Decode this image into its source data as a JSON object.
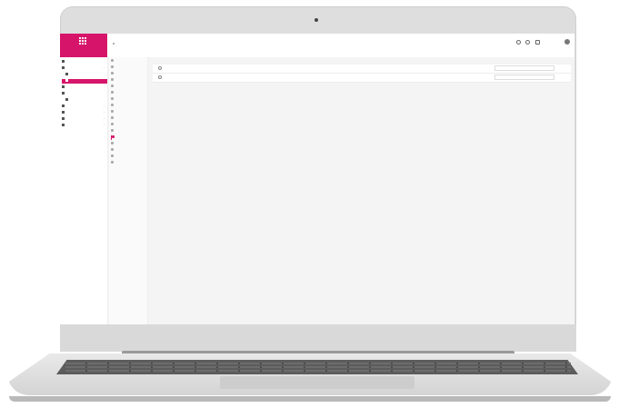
{
  "app": {
    "brand": {
      "name": ""
    },
    "header": {
      "title": "",
      "subtitle": "",
      "user_name": "",
      "sub_right": ""
    },
    "primary_nav": [
      {
        "label": "",
        "icon": "home-icon"
      },
      {
        "label": "",
        "icon": "box-icon",
        "expandable": true
      },
      {
        "label": "",
        "icon": "tag-icon",
        "child": true
      },
      {
        "label": "",
        "icon": "grid-icon",
        "child": true,
        "active": true
      },
      {
        "label": "",
        "icon": "list-icon"
      },
      {
        "label": "",
        "icon": "user-icon"
      },
      {
        "label": "",
        "icon": "chart-icon",
        "child": true
      },
      {
        "label": "",
        "icon": "doc-icon",
        "expandable": true
      },
      {
        "label": "",
        "icon": "folder-icon",
        "expandable": true
      },
      {
        "label": "",
        "icon": "settings-icon",
        "expandable": true
      },
      {
        "label": "",
        "icon": "cart-icon",
        "expandable": true
      }
    ],
    "secondary_nav": [
      {
        "label": "",
        "icon": "item-icon"
      },
      {
        "label": "",
        "icon": "item-icon"
      },
      {
        "label": "",
        "icon": "item-icon"
      },
      {
        "label": "",
        "icon": "item-icon"
      },
      {
        "label": "",
        "icon": "item-icon"
      },
      {
        "label": "",
        "icon": "item-icon"
      },
      {
        "label": "",
        "icon": "item-icon"
      },
      {
        "label": "",
        "icon": "item-icon"
      },
      {
        "label": "",
        "icon": "item-icon"
      },
      {
        "label": "",
        "icon": "item-icon"
      },
      {
        "label": "",
        "icon": "item-icon"
      },
      {
        "label": "",
        "icon": "item-icon"
      },
      {
        "label": "",
        "icon": "item-icon",
        "active": true
      },
      {
        "label": "",
        "icon": "item-icon"
      },
      {
        "label": "",
        "icon": "item-icon"
      },
      {
        "label": "",
        "icon": "item-icon"
      },
      {
        "label": "",
        "icon": "item-icon"
      }
    ],
    "rows": [
      {
        "name": "",
        "date": "",
        "value": "",
        "status": ""
      },
      {
        "name": "",
        "date": "",
        "value": "",
        "status": ""
      }
    ],
    "colors": {
      "accent": "#d6156a",
      "background": "#f4f4f4"
    }
  }
}
